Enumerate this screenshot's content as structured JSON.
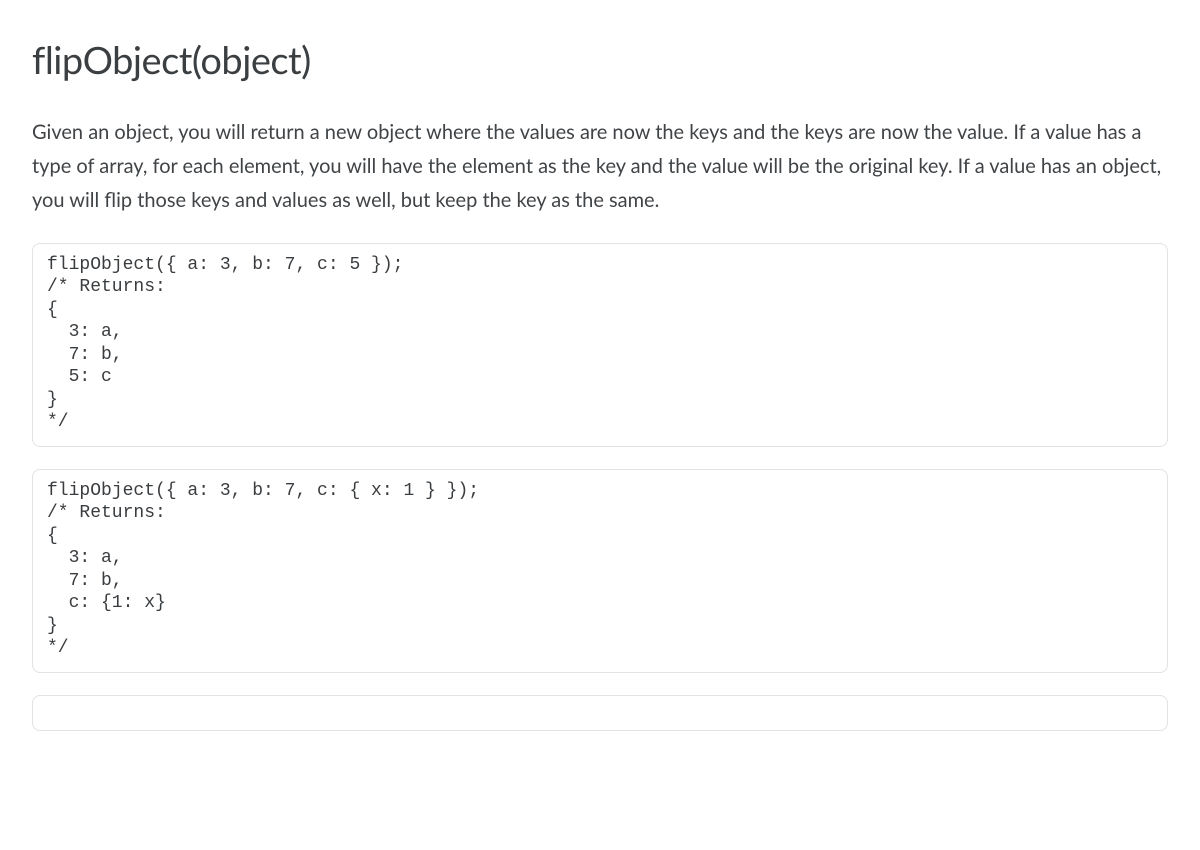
{
  "title": "flipObject(object)",
  "description": "Given an object, you will return a new object where the values are now the keys and the keys are now the value. If a value has a type of array, for each element, you will have the element as the key and the value will be the original key. If a value has an object, you will flip those keys and values as well, but keep the key as the same.",
  "code_blocks": [
    "flipObject({ a: 3, b: 7, c: 5 });\n/* Returns:\n{\n  3: a,\n  7: b,\n  5: c\n}\n*/",
    "flipObject({ a: 3, b: 7, c: { x: 1 } });\n/* Returns:\n{\n  3: a,\n  7: b,\n  c: {1: x}\n}\n*/",
    ""
  ]
}
